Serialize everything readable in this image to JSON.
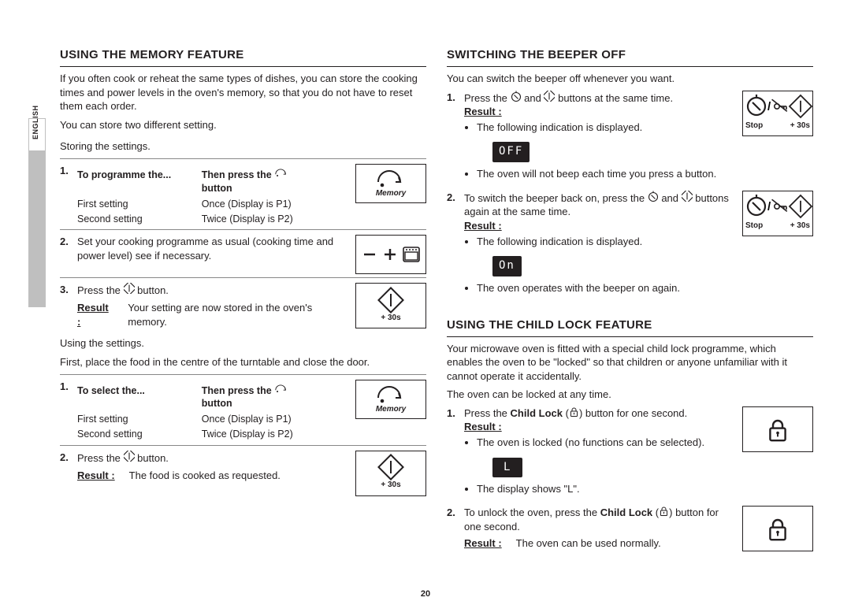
{
  "lang_tab": "ENGLISH",
  "page_number": "20",
  "left": {
    "h_memory": "USING THE MEMORY FEATURE",
    "intro1": "If you often cook or reheat the same types of dishes, you can store the cooking times and power levels in the oven's memory, so that you do not have to reset them each order.",
    "intro2": "You can store two different setting.",
    "storing_head": "Storing the settings.",
    "tbl1_h1": "To programme the...",
    "tbl1_h2": "Then press the",
    "tbl1_h2b": "button",
    "tbl_r1c1": "First setting",
    "tbl_r1c2": "Once (Display is P1)",
    "tbl_r2c1": "Second setting",
    "tbl_r2c2": "Twice (Display is P2)",
    "step2": "Set your cooking programme as usual (cooking time and power level) see if necessary.",
    "step3": "Press the ",
    "step3b": " button.",
    "result_lbl": "Result :",
    "step3_result": "Your setting are now stored in the oven's memory.",
    "using_head": "Using the settings.",
    "using_intro": "First, place the food in the centre of the turntable and close the door.",
    "tbl2_h1": "To select the...",
    "tbl2_h2": "Then press the",
    "tbl2_h2b": "button",
    "u_step2": "Press the ",
    "u_step2b": " button.",
    "u_step2_result": "The food is cooked as requested.",
    "icon_memory_label": "Memory",
    "icon_plus30s": "+ 30s"
  },
  "right": {
    "h_beeper": "SWITCHING THE BEEPER OFF",
    "b_intro": "You can switch the beeper off whenever you want.",
    "b_step1": "Press the ",
    "b_step1m": " and ",
    "b_step1b": " buttons at the same time.",
    "result_lbl": "Result :",
    "b_r1_bul1": "The following indication is displayed.",
    "disp_off": "OFF",
    "b_r1_bul2": "The oven will not beep each time you press a button.",
    "b_step2": "To switch the beeper back on, press the ",
    "b_step2m": " and ",
    "b_step2b": " buttons again at the same time.",
    "b_r2_bul1": "The following indication is displayed.",
    "disp_on": "On",
    "b_r2_bul2": "The oven operates with the beeper on again.",
    "h_child": "USING THE CHILD LOCK FEATURE",
    "c_intro1": "Your microwave oven is fitted with a special child lock programme, which enables the oven to be \"locked\" so that children or anyone unfamiliar with it cannot operate it accidentally.",
    "c_intro2": "The oven can be locked at any time.",
    "c_step1a": "Press the ",
    "c_step1b": "Child Lock",
    "c_step1c": " (",
    "c_step1d": ") button for one second.",
    "c_r1_bul1": "The oven is locked (no functions can be selected).",
    "disp_L": "L",
    "c_r1_bul2": "The display shows \"L\".",
    "c_step2a": "To unlock the oven, press the ",
    "c_step2b": "Child Lock",
    "c_step2c": " (",
    "c_step2d": ") button for one second.",
    "c_r2": "The oven can be used normally.",
    "icon_stop_label": "Stop",
    "icon_plus30s": "+ 30s"
  }
}
